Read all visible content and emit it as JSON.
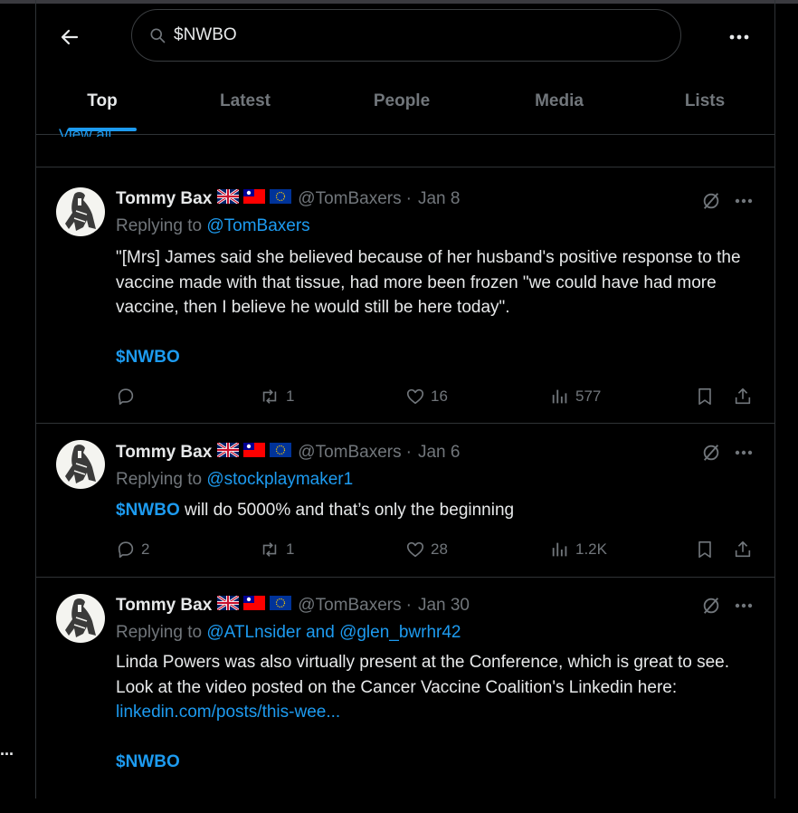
{
  "search": {
    "query": "$NWBO"
  },
  "tabs": [
    {
      "label": "Top",
      "active": true
    },
    {
      "label": "Latest"
    },
    {
      "label": "People"
    },
    {
      "label": "Media"
    },
    {
      "label": "Lists"
    }
  ],
  "peek_text": "View all",
  "colors": {
    "accent": "#1d9bf0",
    "muted": "#71767b",
    "text": "#e7e9ea",
    "border": "#2f3336",
    "background": "#000000"
  },
  "tweets": [
    {
      "name": "Tommy Bax",
      "flags": [
        "uk-flag-icon",
        "taiwan-flag-icon",
        "eu-flag-icon"
      ],
      "handle": "@TomBaxers",
      "date": "Jan 8",
      "replying_prefix": "Replying to ",
      "replying_to": "@TomBaxers",
      "body_text": "\"[Mrs] James said she believed because of her husband's positive response to the vaccine made with that tissue, had more been frozen \"we could have had more vaccine, then I believe he would still be here today\".",
      "cashtag": "$NWBO",
      "stats": {
        "replies": "",
        "reposts": "1",
        "likes": "16",
        "views": "577"
      }
    },
    {
      "name": "Tommy Bax",
      "flags": [
        "uk-flag-icon",
        "taiwan-flag-icon",
        "eu-flag-icon"
      ],
      "handle": "@TomBaxers",
      "date": "Jan 6",
      "replying_prefix": "Replying to ",
      "replying_to": "@stockplaymaker1",
      "cashtag": "$NWBO",
      "body_text": " will do 5000% and that’s only the beginning",
      "stats": {
        "replies": "2",
        "reposts": "1",
        "likes": "28",
        "views": "1.2K"
      }
    },
    {
      "name": "Tommy Bax",
      "flags": [
        "uk-flag-icon",
        "taiwan-flag-icon",
        "eu-flag-icon"
      ],
      "handle": "@TomBaxers",
      "date": "Jan 30",
      "replying_prefix": "Replying to ",
      "replying_to": "@ATLnsider and @glen_bwrhr42",
      "body_text": "Linda Powers was also virtually present at the Conference, which is great to see. Look at the video posted on the Cancer Vaccine Coalition's Linkedin here:",
      "link": "linkedin.com/posts/this-wee...",
      "cashtag": "$NWBO"
    }
  ],
  "separator": "·",
  "sidebar_more": "..."
}
